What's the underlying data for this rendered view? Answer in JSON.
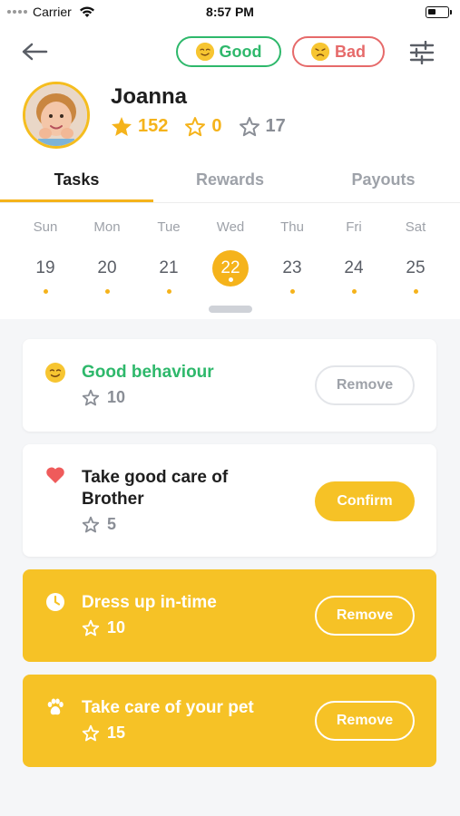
{
  "status_bar": {
    "carrier": "Carrier",
    "time": "8:57 PM"
  },
  "header": {
    "back_icon": "arrow-left-icon",
    "good_label": "Good",
    "bad_label": "Bad",
    "filter_icon": "sliders-icon"
  },
  "profile": {
    "name": "Joanna",
    "stars_earned": "152",
    "stars_outline": "0",
    "stars_gray": "17"
  },
  "tabs": [
    {
      "label": "Tasks",
      "active": true
    },
    {
      "label": "Rewards",
      "active": false
    },
    {
      "label": "Payouts",
      "active": false
    }
  ],
  "week": [
    {
      "name": "Sun",
      "num": "19"
    },
    {
      "name": "Mon",
      "num": "20"
    },
    {
      "name": "Tue",
      "num": "21"
    },
    {
      "name": "Wed",
      "num": "22",
      "selected": true
    },
    {
      "name": "Thu",
      "num": "23"
    },
    {
      "name": "Fri",
      "num": "24"
    },
    {
      "name": "Sat",
      "num": "25"
    }
  ],
  "tasks": [
    {
      "icon": "smile-emoji-icon",
      "title": "Good behaviour",
      "points": "10",
      "button": "Remove",
      "style": "good"
    },
    {
      "icon": "heart-icon",
      "title_line1": "Take good care of",
      "title_line2": "Brother",
      "points": "5",
      "button": "Confirm",
      "style": "pending"
    },
    {
      "icon": "clock-icon",
      "title": "Dress up in-time",
      "points": "10",
      "button": "Remove",
      "style": "done"
    },
    {
      "icon": "paw-icon",
      "title": "Take care of your pet",
      "points": "15",
      "button": "Remove",
      "style": "done"
    }
  ],
  "colors": {
    "accent": "#f5b31b",
    "good": "#2eb86b",
    "bad": "#e66a6a",
    "card_highlight": "#f6c226"
  }
}
